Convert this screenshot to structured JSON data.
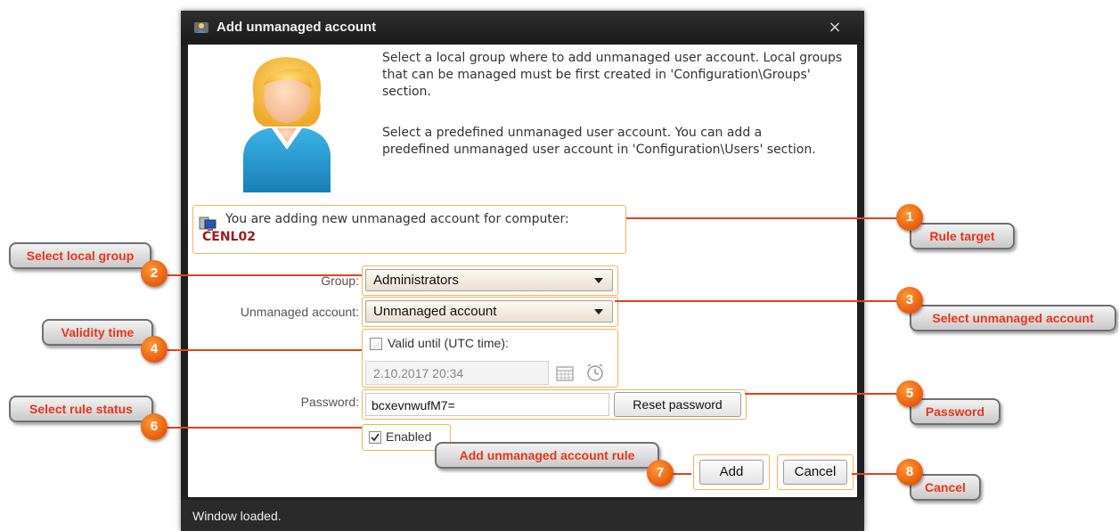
{
  "window": {
    "title": "Add unmanaged account",
    "close_glyph": "×",
    "status": "Window loaded."
  },
  "description": {
    "group_hint": "Select a local group where to add unmanaged user account. Local groups that can be managed must be first created in 'Configuration\\Groups' section.",
    "account_hint": "Select a predefined unmanaged user account. You can add a predefined unmanaged user account in 'Configuration\\Users' section."
  },
  "target": {
    "message": "You are adding new unmanaged account for computer:",
    "computer": "CENL02",
    "icon": "computer-icon"
  },
  "form": {
    "group_label": "Group:",
    "group_value": "Administrators",
    "account_label": "Unmanaged account:",
    "account_value": "Unmanaged account",
    "valid_until_label": "Valid until (UTC time):",
    "valid_until_checked": false,
    "valid_until_value": "2.10.2017 20:34",
    "password_label": "Password:",
    "password_value": "bcxevnwufM7=",
    "reset_password_label": "Reset password",
    "enabled_label": "Enabled",
    "enabled_checked": true
  },
  "buttons": {
    "add": "Add",
    "cancel": "Cancel"
  },
  "callouts": [
    {
      "num": "1",
      "label": "Rule target"
    },
    {
      "num": "2",
      "label": "Select local group"
    },
    {
      "num": "3",
      "label": "Select unmanaged account"
    },
    {
      "num": "4",
      "label": "Validity time"
    },
    {
      "num": "5",
      "label": "Password"
    },
    {
      "num": "6",
      "label": "Select rule status"
    },
    {
      "num": "7",
      "label": "Add unmanaged account rule"
    },
    {
      "num": "8",
      "label": "Cancel"
    }
  ],
  "colors": {
    "callout_text": "#e8351c",
    "highlight_border": "#f4b45c",
    "computer_name": "#9b1a1a"
  }
}
